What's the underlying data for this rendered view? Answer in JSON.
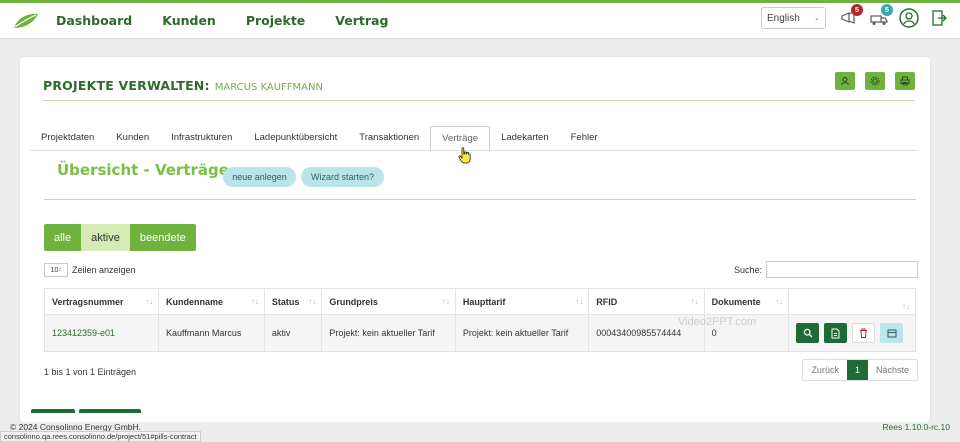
{
  "nav": {
    "links": [
      "Dashboard",
      "Kunden",
      "Projekte",
      "Vertrag"
    ],
    "language": "English",
    "badges": {
      "alerts": "5",
      "tasks": "5"
    }
  },
  "header": {
    "title": "PROJEKTE VERWALTEN:",
    "customer": "MARCUS KAUFFMANN"
  },
  "tabs": [
    "Projektdaten",
    "Kunden",
    "Infrastrukturen",
    "Ladepunktübersicht",
    "Transaktionen",
    "Verträge",
    "Ladekarten",
    "Fehler"
  ],
  "section": {
    "title": "Übersicht - Verträge",
    "new_button": "neue anlegen",
    "wizard_button": "Wizard starten?"
  },
  "filters": [
    "alle",
    "aktive",
    "beendete"
  ],
  "table_controls": {
    "page_length": "10",
    "page_length_label": "Zeilen anzeigen",
    "search_label": "Suche:"
  },
  "table": {
    "columns": [
      "Vertragsnummer",
      "Kundenname",
      "Status",
      "Grundpreis",
      "Haupttarif",
      "RFID",
      "Dokumente",
      ""
    ],
    "rows": [
      {
        "vertragsnummer": "123412359-e01",
        "kundenname": "Kauffmann Marcus",
        "status": "aktiv",
        "grundpreis": "Projekt: kein aktueller Tarif",
        "haupttarif": "Projekt: kein aktueller Tarif",
        "rfid": "00043400985574444",
        "dokumente": "0"
      }
    ]
  },
  "pagination": {
    "info": "1 bis 1 von 1 Einträgen",
    "prev": "Zurück",
    "current": "1",
    "next": "Nächste"
  },
  "watermark": "Video2PPT.com",
  "footer": {
    "copyright": "© 2024 Consolinno Energy GmbH.",
    "version": "Rees 1.10.0-rc.10",
    "status_url": "consolinno.qa.rees.consolinno.de/project/51#pills-contract"
  },
  "colors": {
    "brand_green": "#2d6b2b",
    "accent_green": "#6fb23f",
    "dark_green": "#1e6b38",
    "teal": "#b9e4e8",
    "badge_red": "#b1262c"
  }
}
